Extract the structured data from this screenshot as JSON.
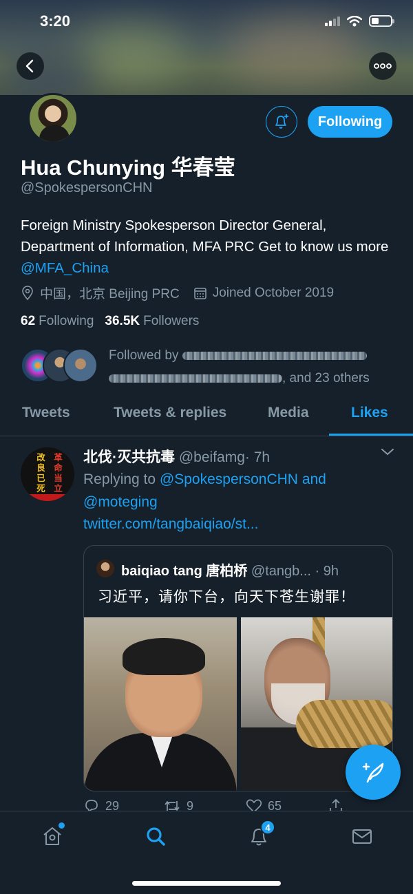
{
  "status_bar": {
    "time": "3:20"
  },
  "header": {
    "back_icon": "chevron-left-icon",
    "more_icon": "more-icon"
  },
  "profile": {
    "name": "Hua Chunying 华春莹",
    "handle": "@SpokespersonCHN",
    "bio_text": "Foreign Ministry Spokesperson Director General, Department of Information, MFA PRC Get to know us more ",
    "bio_link": "@MFA_China",
    "location": "中国，北京 Beijing PRC",
    "joined": "Joined October 2019",
    "following_count": "62",
    "following_label": "Following",
    "followers_count": "36.5K",
    "followers_label": "Followers",
    "followed_by_prefix": "Followed by",
    "followed_by_suffix": ", and 23 others",
    "follow_button": "Following"
  },
  "tabs": [
    {
      "label": "Tweets",
      "active": false
    },
    {
      "label": "Tweets & replies",
      "active": false
    },
    {
      "label": "Media",
      "active": false
    },
    {
      "label": "Likes",
      "active": true
    }
  ],
  "tweet": {
    "avatar_text": [
      "革",
      "改",
      "命",
      "良",
      "当",
      "已",
      "立",
      "死"
    ],
    "name": "北伐·灭共抗毒",
    "handle": "@beifamg",
    "time": "· 7h",
    "replying_prefix": "Replying to ",
    "replying_user1": "@SpokespersonCHN",
    "replying_and": " and ",
    "replying_user2": "@moteging",
    "link": "twitter.com/tangbaiqiao/st...",
    "quote": {
      "name": "baiqiao tang 唐柏桥",
      "handle": "@tangb...",
      "time": "· 9h",
      "text": "习近平，请你下台，向天下苍生谢罪！"
    },
    "replies": "29",
    "retweets": "9",
    "likes": "65"
  },
  "bottom_nav": {
    "notifications_badge": "4"
  },
  "colors": {
    "background": "#15202b",
    "accent": "#1da1f2",
    "muted": "#8899a6",
    "divider": "#38444d"
  }
}
